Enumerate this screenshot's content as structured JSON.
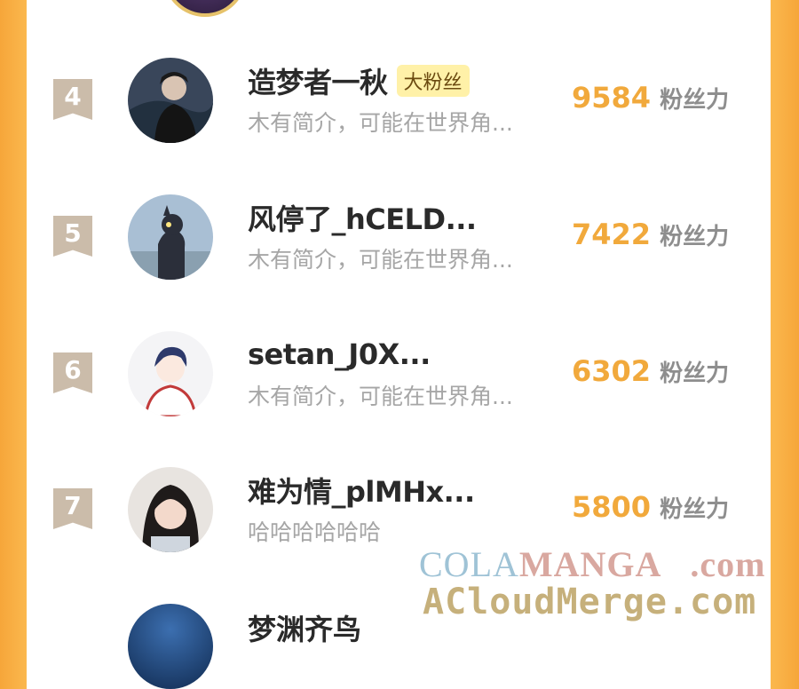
{
  "ranking": {
    "items": [
      {
        "rank": "4",
        "name": "造梦者一秋",
        "badge": "大粉丝",
        "bio": "木有简介，可能在世界角...",
        "score": "9584",
        "unit": "粉丝力"
      },
      {
        "rank": "5",
        "name": "风停了_hCELD...",
        "badge": "",
        "bio": "木有简介，可能在世界角...",
        "score": "7422",
        "unit": "粉丝力"
      },
      {
        "rank": "6",
        "name": "setan_J0X...",
        "badge": "",
        "bio": "木有简介，可能在世界角...",
        "score": "6302",
        "unit": "粉丝力"
      },
      {
        "rank": "7",
        "name": "难为情_plMHx...",
        "badge": "",
        "bio": "哈哈哈哈哈哈",
        "score": "5800",
        "unit": "粉丝力"
      }
    ],
    "partial_next_name": "梦渊齐鸟"
  },
  "watermark": {
    "line1_a": "COLA",
    "line1_b": "MANGA",
    "line1_c": ".com",
    "line2": "ACloudMerge.com"
  },
  "colors": {
    "accent": "#f1a93c",
    "rank_ribbon": "#cbbcaa",
    "badge_bg": "#fff1a8",
    "side_orange": "#f6a63a"
  }
}
